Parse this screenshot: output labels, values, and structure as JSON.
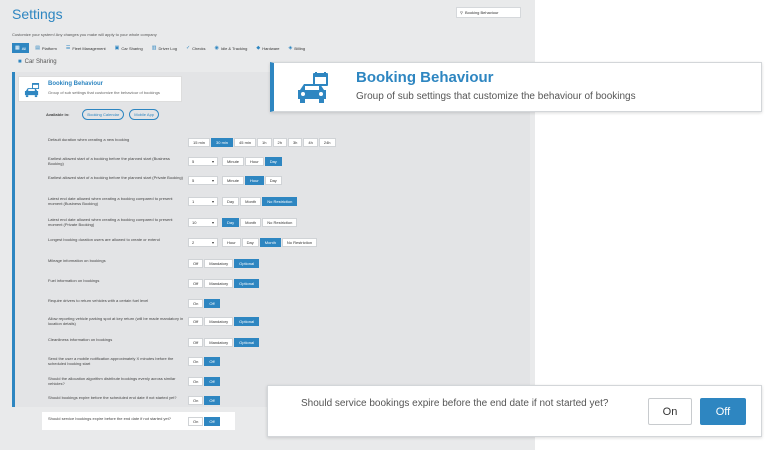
{
  "app": {
    "title": "Settings",
    "subtitle": "Customize your system! Any changes you make will apply to your whole company",
    "search_value": "Booking Behaviour",
    "tabs": [
      {
        "label": "All",
        "icon": "grid-icon",
        "active": true
      },
      {
        "label": "Platform",
        "icon": "platform-icon",
        "active": false
      },
      {
        "label": "Fleet Management",
        "icon": "fleet-icon",
        "active": false
      },
      {
        "label": "Car Sharing",
        "icon": "car-icon",
        "active": false
      },
      {
        "label": "Driver Log",
        "icon": "log-icon",
        "active": false
      },
      {
        "label": "Checks",
        "icon": "check-icon",
        "active": false
      },
      {
        "label": "Idle & Tracking",
        "icon": "tracking-icon",
        "active": false
      },
      {
        "label": "Hardware",
        "icon": "hardware-icon",
        "active": false
      },
      {
        "label": "Billing",
        "icon": "billing-icon",
        "active": false
      }
    ],
    "section_label": "Car Sharing",
    "mini_header": {
      "title": "Booking Behaviour",
      "subtitle": "Group of sub settings that customize the behaviour of bookings"
    },
    "available_in": {
      "label": "Available in:",
      "pills": [
        "Booking Calendar",
        "Mobile App"
      ]
    },
    "rows": [
      {
        "label": "Default duration when creating a new booking",
        "dropdown": null,
        "options": [
          "15 min",
          "30 min",
          "45 min",
          "1h",
          "2h",
          "3h",
          "4h",
          "24h"
        ],
        "selected": 1
      },
      {
        "label": "Earliest allowed start of a booking before the planned start (Business Booking)",
        "dropdown": "5",
        "options": [
          "Minute",
          "Hour",
          "Day"
        ],
        "selected": 2
      },
      {
        "label": "Earliest allowed start of a booking before the planned start (Private Booking)",
        "dropdown": "5",
        "options": [
          "Minute",
          "Hour",
          "Day"
        ],
        "selected": 1
      },
      {
        "label": "Latest end date allowed when creating a booking compared to present moment (Business Booking)",
        "dropdown": "1",
        "options": [
          "Day",
          "Month",
          "No Restriction"
        ],
        "selected": 2
      },
      {
        "label": "Latest end date allowed when creating a booking compared to present moment (Private Booking)",
        "dropdown": "10",
        "options": [
          "Day",
          "Month",
          "No Restriction"
        ],
        "selected": 0
      },
      {
        "label": "Longest booking duration users are allowed to create or extend",
        "dropdown": "2",
        "options": [
          "Hour",
          "Day",
          "Month",
          "No Restriction"
        ],
        "selected": 2
      },
      {
        "label": "Mileage information on bookings",
        "dropdown": null,
        "options": [
          "Off",
          "Mandatory",
          "Optional"
        ],
        "selected": 2
      },
      {
        "label": "Fuel information on bookings",
        "dropdown": null,
        "options": [
          "Off",
          "Mandatory",
          "Optional"
        ],
        "selected": 2
      },
      {
        "label": "Require drivers to return vehicles with a certain fuel level",
        "dropdown": null,
        "options": [
          "On",
          "Off"
        ],
        "selected": 1
      },
      {
        "label": "Allow reporting vehicle parking spot at key return (will be made mandatory in location details)",
        "dropdown": null,
        "options": [
          "Off",
          "Mandatory",
          "Optional"
        ],
        "selected": 2
      },
      {
        "label": "Cleanliness information on bookings",
        "dropdown": null,
        "options": [
          "Off",
          "Mandatory",
          "Optional"
        ],
        "selected": 2
      },
      {
        "label": "Send the user a mobile notification approximately X minutes before the scheduled booking start",
        "dropdown": null,
        "options": [
          "On",
          "Off"
        ],
        "selected": 1
      },
      {
        "label": "Should the allocation algorithm distribute bookings evenly across similar vehicles?",
        "dropdown": null,
        "options": [
          "On",
          "Off"
        ],
        "selected": 1
      },
      {
        "label": "Should bookings expire before the scheduled end date if not started yet?",
        "dropdown": null,
        "options": [
          "On",
          "Off"
        ],
        "selected": 1
      },
      {
        "label": "Should service bookings expire before the end date if not started yet?",
        "dropdown": null,
        "options": [
          "On",
          "Off"
        ],
        "selected": 1
      }
    ]
  },
  "callout_header": {
    "title": "Booking Behaviour",
    "subtitle": "Group of sub settings that customize the behaviour of bookings",
    "icon": "calendar-car-icon"
  },
  "callout_question": {
    "question": "Should service bookings expire before the end date if not started yet?",
    "on_label": "On",
    "off_label": "Off",
    "selected": "Off"
  },
  "colors": {
    "accent": "#2e86c1",
    "app_bg": "#e9eaeb"
  }
}
